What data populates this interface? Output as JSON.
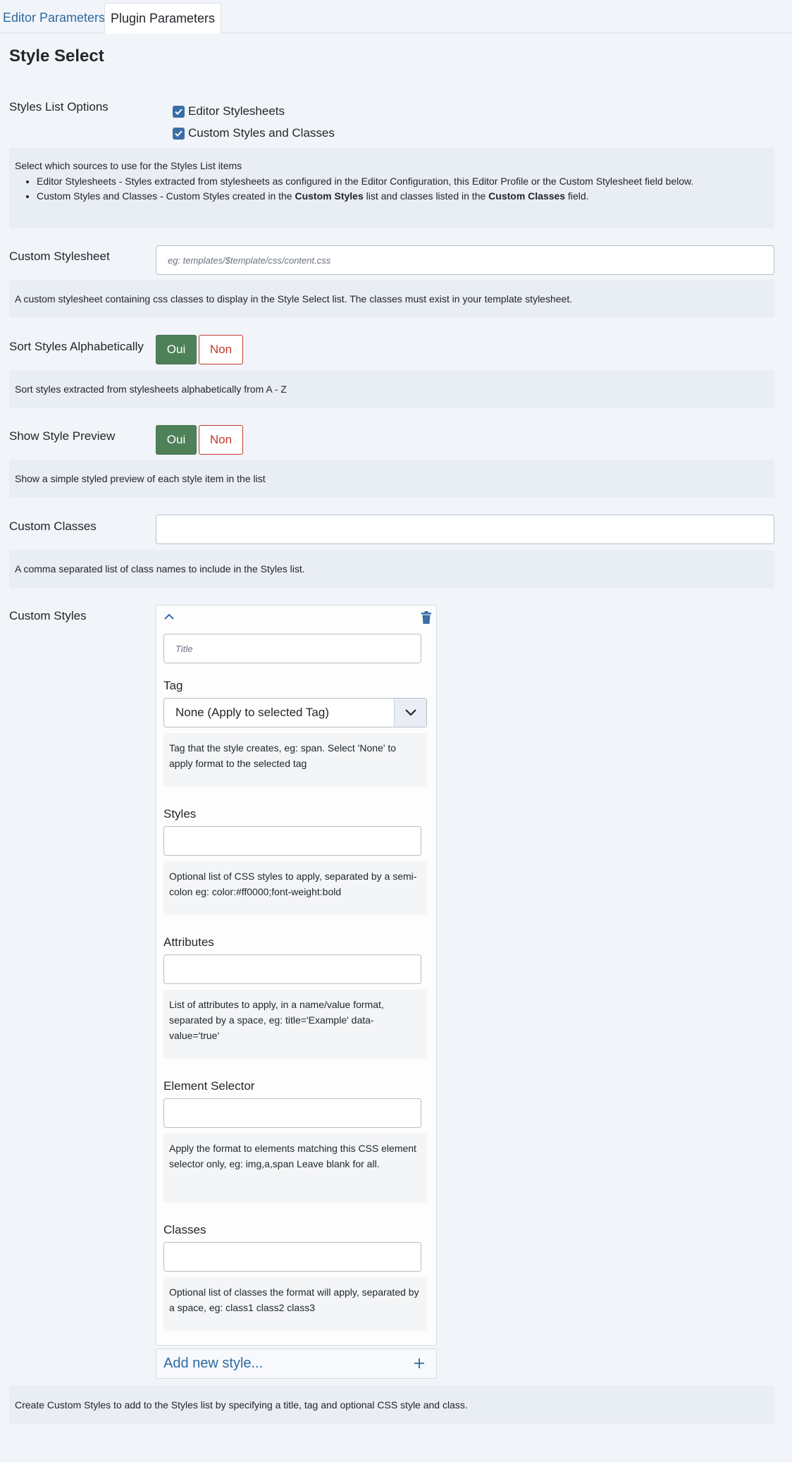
{
  "tabs": {
    "editor": "Editor Parameters",
    "plugin": "Plugin Parameters"
  },
  "section_title": "Style Select",
  "styles_list": {
    "label": "Styles List Options",
    "option1": "Editor Stylesheets",
    "option2": "Custom Styles and Classes",
    "desc_intro": "Select which sources to use for the Styles List items",
    "bullet1": "Editor Stylesheets - Styles extracted from stylesheets as configured in the Editor Configuration, this Editor Profile or the Custom Stylesheet field below.",
    "bullet2_a": "Custom Styles and Classes - Custom Styles created in the ",
    "bullet2_b": "Custom Styles",
    "bullet2_c": " list and classes listed in the ",
    "bullet2_d": "Custom Classes",
    "bullet2_e": " field."
  },
  "custom_stylesheet": {
    "label": "Custom Stylesheet",
    "placeholder": "eg: templates/$template/css/content.css",
    "desc": "A custom stylesheet containing css classes to display in the Style Select list. The classes must exist in your template stylesheet."
  },
  "sort_styles": {
    "label": "Sort Styles Alphabetically",
    "yes": "Oui",
    "no": "Non",
    "desc": "Sort styles extracted from stylesheets alphabetically from A - Z"
  },
  "show_preview": {
    "label": "Show Style Preview",
    "yes": "Oui",
    "no": "Non",
    "desc": "Show a simple styled preview of each style item in the list"
  },
  "custom_classes": {
    "label": "Custom Classes",
    "value": "",
    "desc": "A comma separated list of class names to include in the Styles list."
  },
  "custom_styles": {
    "label": "Custom Styles",
    "title_placeholder": "Title",
    "tag_label": "Tag",
    "tag_value": "None (Apply to selected Tag)",
    "tag_desc": "Tag that the style creates, eg: span. Select 'None' to apply format to the selected tag",
    "styles_label": "Styles",
    "styles_desc": "Optional list of CSS styles to apply, separated by a semi-colon eg: color:#ff0000;font-weight:bold",
    "attributes_label": "Attributes",
    "attributes_desc": "List of attributes to apply, in a name/value format, separated by a space, eg: title='Example' data-value='true'",
    "selector_label": "Element Selector",
    "selector_desc": "Apply the format to elements matching this CSS element selector only, eg: img,a,span Leave blank for all.",
    "classes_label": "Classes",
    "classes_desc": "Optional list of classes the format will apply, separated by a space, eg: class1 class2 class3",
    "add_label": "Add new style...",
    "desc": "Create Custom Styles to add to the Styles list by specifying a title, tag and optional CSS style and class."
  },
  "icons": {
    "checkbox": "check-icon",
    "collapse": "chevron-up-icon",
    "delete": "trash-icon",
    "dropdown": "chevron-down-icon",
    "add": "plus-icon"
  },
  "colors": {
    "accent": "#3a6ea5",
    "link": "#2d6aa0",
    "yes": "#4f8159",
    "no": "#c0392b"
  }
}
